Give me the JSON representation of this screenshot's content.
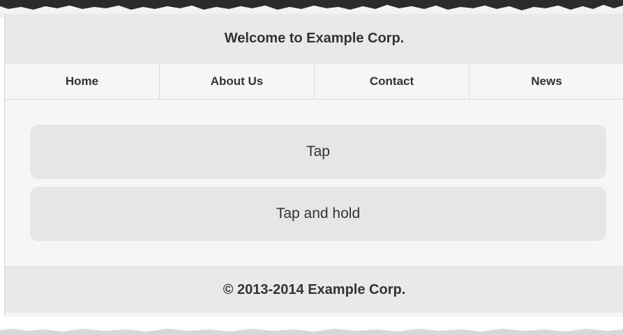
{
  "header": {
    "title": "Welcome to Example Corp."
  },
  "navbar": {
    "items": [
      {
        "label": "Home"
      },
      {
        "label": "About Us"
      },
      {
        "label": "Contact"
      },
      {
        "label": "News"
      }
    ]
  },
  "main": {
    "buttons": [
      {
        "label": "Tap"
      },
      {
        "label": "Tap and hold"
      }
    ]
  },
  "footer": {
    "text": "© 2013-2014 Example Corp."
  },
  "colors": {
    "header_bg": "#e9e9e9",
    "page_bg": "#f6f6f6",
    "button_bg": "#e6e6e6",
    "text": "#333333"
  }
}
